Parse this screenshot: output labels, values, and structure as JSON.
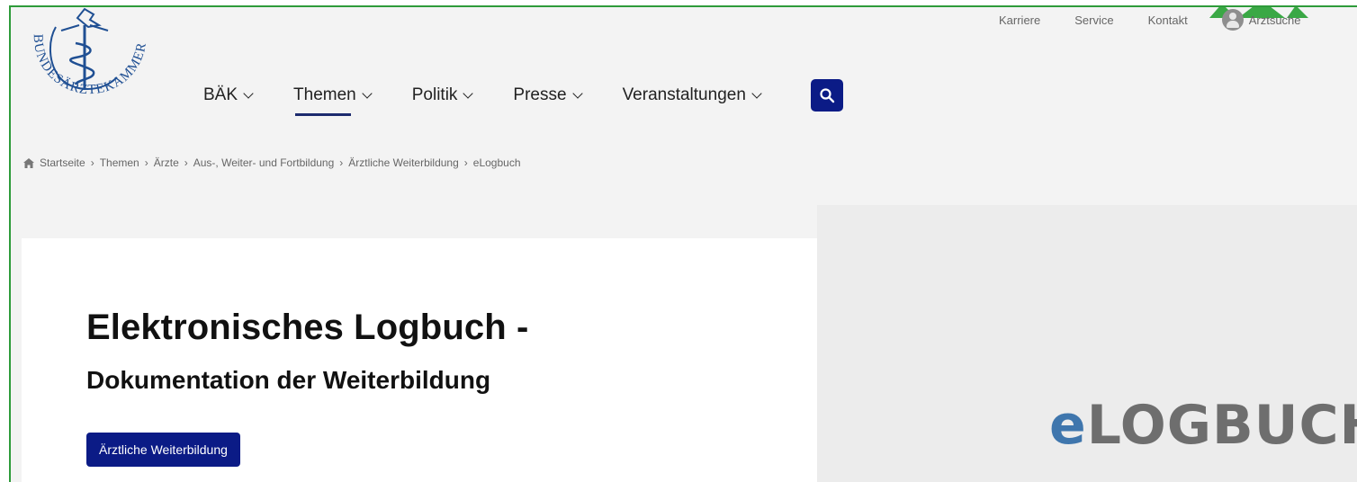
{
  "logo": {
    "alt": "Bundesärztekammer",
    "text": "BUNDESÄRZTEKAMMER"
  },
  "utility_nav": [
    {
      "label": "Karriere"
    },
    {
      "label": "Service"
    },
    {
      "label": "Kontakt"
    },
    {
      "label": "Arztsuche",
      "icon": "person-icon"
    }
  ],
  "main_nav": [
    {
      "label": "BÄK",
      "active": false
    },
    {
      "label": "Themen",
      "active": true
    },
    {
      "label": "Politik",
      "active": false
    },
    {
      "label": "Presse",
      "active": false
    },
    {
      "label": "Veranstaltungen",
      "active": false
    }
  ],
  "search": {
    "icon": "search-icon"
  },
  "breadcrumb": {
    "home_icon": "home-icon",
    "items": [
      "Startseite",
      "Themen",
      "Ärzte",
      "Aus-, Weiter- und Fortbildung",
      "Ärztliche Weiterbildung",
      "eLogbuch"
    ],
    "separator": "›"
  },
  "content": {
    "title": "Elektronisches Logbuch -",
    "subtitle": "Dokumentation der Weiterbildung",
    "button_label": "Ärztliche Weiterbildung"
  },
  "hero": {
    "logo_e": "e",
    "logo_rest": "LOGBUCH"
  },
  "colors": {
    "primary": "#0b1b86",
    "frame_green": "#2e9b3a",
    "logo_blue": "#1f4f93",
    "elog_blue": "#3f76ad",
    "elog_gray": "#6e6e6e"
  }
}
